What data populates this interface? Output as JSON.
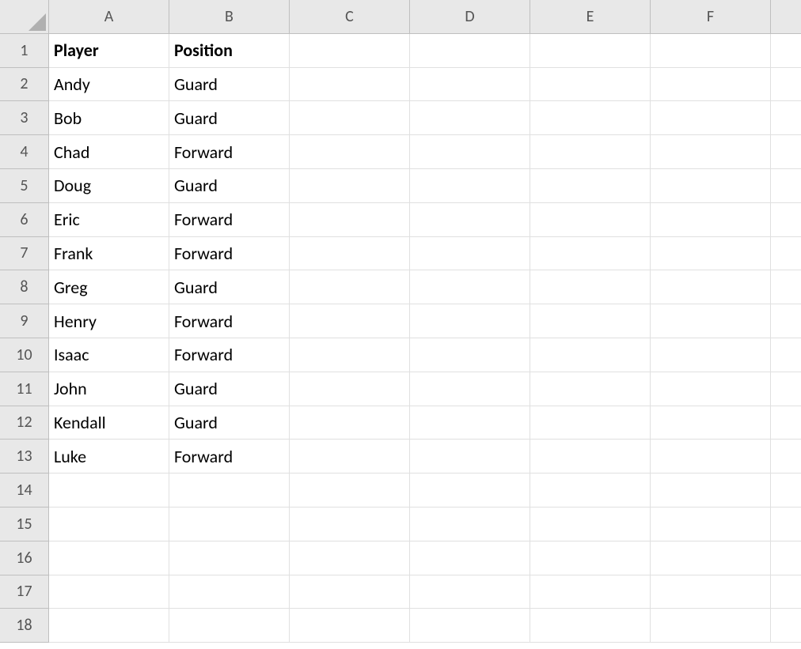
{
  "columns": [
    "A",
    "B",
    "C",
    "D",
    "E",
    "F"
  ],
  "rowCount": 18,
  "headers": {
    "A": "Player",
    "B": "Position"
  },
  "rows": [
    {
      "A": "Andy",
      "B": "Guard"
    },
    {
      "A": "Bob",
      "B": "Guard"
    },
    {
      "A": "Chad",
      "B": "Forward"
    },
    {
      "A": "Doug",
      "B": "Guard"
    },
    {
      "A": "Eric",
      "B": "Forward"
    },
    {
      "A": "Frank",
      "B": "Forward"
    },
    {
      "A": "Greg",
      "B": "Guard"
    },
    {
      "A": "Henry",
      "B": "Forward"
    },
    {
      "A": "Isaac",
      "B": "Forward"
    },
    {
      "A": "John",
      "B": "Guard"
    },
    {
      "A": "Kendall",
      "B": "Guard"
    },
    {
      "A": "Luke",
      "B": "Forward"
    }
  ]
}
